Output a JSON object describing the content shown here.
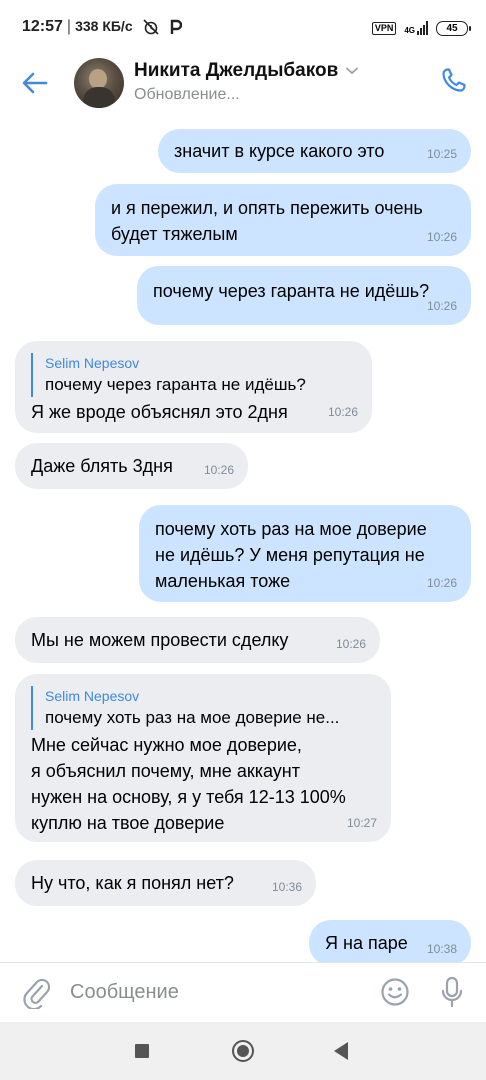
{
  "status_bar": {
    "time": "12:57",
    "speed": "338 КБ/с",
    "vpn_label": "VPN",
    "network": "4G",
    "battery": "45",
    "icons": [
      "alarm-off-icon",
      "p-icon",
      "signal-icon",
      "battery-icon"
    ]
  },
  "header": {
    "name": "Никита Джелдыбаков",
    "subtitle": "Обновление..."
  },
  "messages": [
    {
      "dir": "out",
      "text": "значит в курсе какого это",
      "time": "10:25"
    },
    {
      "dir": "out",
      "text": "и я пережил, и опять пережить очень\nбудет тяжелым",
      "time": "10:26"
    },
    {
      "dir": "out",
      "text": "почему через гаранта не идёшь?",
      "time": "10:26"
    },
    {
      "dir": "in",
      "reply_name": "Selim Nepesov",
      "reply_text": "почему через гаранта не идёшь?",
      "text": "Я же вроде объяснял это 2дня",
      "time": "10:26"
    },
    {
      "dir": "in",
      "text": "Даже блять 3дня",
      "time": "10:26"
    },
    {
      "dir": "out",
      "text": "почему хоть раз на мое доверие\nне идёшь? У меня репутация не\nмаленькая тоже",
      "time": "10:26"
    },
    {
      "dir": "in",
      "text": "Мы не можем провести сделку",
      "time": "10:26"
    },
    {
      "dir": "in",
      "reply_name": "Selim Nepesov",
      "reply_text": "почему хоть раз на мое доверие не...",
      "text": "Мне сейчас нужно мое доверие,\nя объяснил почему,  мне аккаунт\nнужен на основу,  я у тебя 12-13 100%\nкуплю на твое доверие",
      "time": "10:27"
    },
    {
      "dir": "in",
      "text": "Ну что,  как я понял нет?",
      "time": "10:36"
    },
    {
      "dir": "out",
      "text": "Я на паре",
      "time": "10:38"
    }
  ],
  "input": {
    "placeholder": "Сообщение"
  },
  "colors": {
    "accent": "#3f8ae0",
    "outgoing_bubble": "#cce4ff",
    "incoming_bubble": "#ebedf0",
    "time_text": "#818c99"
  }
}
